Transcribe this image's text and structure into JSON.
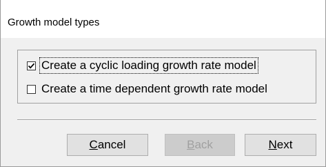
{
  "dialog": {
    "title": "Growth model types"
  },
  "options": [
    {
      "label": "Create a cyclic loading growth rate model",
      "checked": true
    },
    {
      "label": "Create a time dependent growth rate model",
      "checked": false
    }
  ],
  "buttons": {
    "cancel": {
      "mnemonic": "C",
      "rest": "ancel",
      "enabled": true
    },
    "back": {
      "mnemonic": "B",
      "rest": "ack",
      "enabled": false
    },
    "next": {
      "mnemonic": "N",
      "rest": "ext",
      "enabled": true
    }
  }
}
